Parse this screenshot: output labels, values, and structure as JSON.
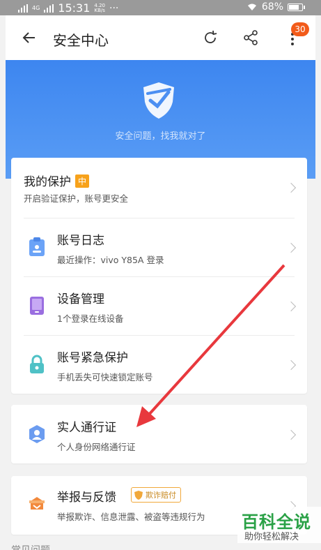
{
  "status_bar": {
    "network": "4G",
    "time": "15:31",
    "speed": "4.20\nKB/s",
    "dots": "···",
    "battery": "68%"
  },
  "app_bar": {
    "title": "安全中心",
    "notification_count": "30"
  },
  "hero": {
    "subtitle": "安全问题，找我就对了"
  },
  "protection": {
    "title": "我的保护",
    "level": "中",
    "subtitle": "开启验证保护，账号更安全"
  },
  "items": [
    {
      "title": "账号日志",
      "subtitle": "最近操作：vivo Y85A 登录",
      "icon": "clipboard-icon"
    },
    {
      "title": "设备管理",
      "subtitle": "1个登录在线设备",
      "icon": "tablet-icon"
    },
    {
      "title": "账号紧急保护",
      "subtitle": "手机丢失可快速锁定账号",
      "icon": "lock-icon"
    }
  ],
  "identity": {
    "title": "实人通行证",
    "subtitle": "个人身份网络通行证",
    "icon": "id-shield-icon"
  },
  "report": {
    "title": "举报与反馈",
    "tag": "欺诈赔付",
    "subtitle": "举报欺诈、信息泄露、被盗等违规行为",
    "icon": "report-icon"
  },
  "footer": {
    "label": "常见问题"
  },
  "watermark": {
    "title": "百科全说",
    "subtitle": "助你轻松解决"
  },
  "colors": {
    "accent": "#3d86f0",
    "badge": "#f25b1a",
    "level": "#f7a21b",
    "arrow": "#e8383d"
  }
}
